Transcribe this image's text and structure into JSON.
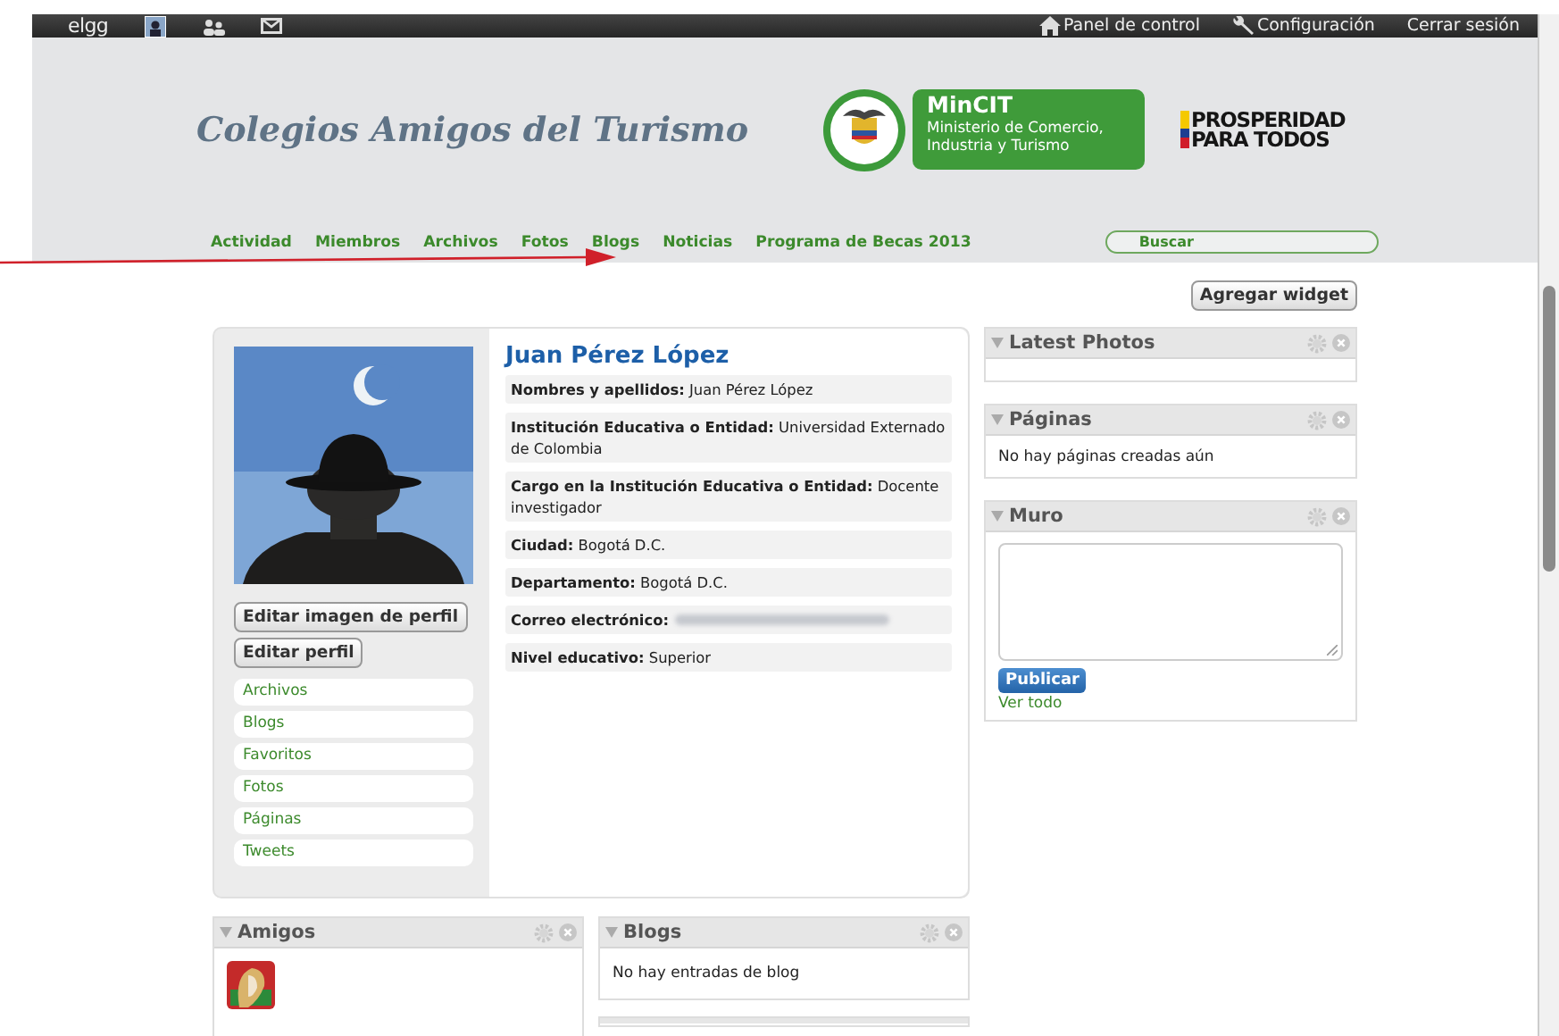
{
  "topbar": {
    "logo": "elgg",
    "icons": [
      {
        "kind": "avatar"
      },
      {
        "kind": "friends"
      },
      {
        "kind": "mail"
      }
    ],
    "links": [
      {
        "kind": "home",
        "label": "Panel de control"
      },
      {
        "kind": "wrench",
        "label": "Configuración"
      },
      {
        "kind": "plain",
        "label": "Cerrar sesión"
      }
    ]
  },
  "header": {
    "title": "Colegios Amigos del Turismo",
    "ministry": {
      "name": "MinCIT",
      "lines": [
        "Ministerio de Comercio,",
        "Industria y Turismo"
      ]
    },
    "slogan": [
      "PROSPERIDAD",
      "PARA TODOS"
    ]
  },
  "nav": {
    "items": [
      "Actividad",
      "Miembros",
      "Archivos",
      "Fotos",
      "Blogs",
      "Noticias",
      "Programa de Becas 2013"
    ],
    "search": {
      "placeholder": "Buscar"
    }
  },
  "add_widget": "Agregar widget",
  "profile": {
    "name": "Juan Pérez López",
    "fields": [
      {
        "kind": "text",
        "text": "**Nombres y apellidos:** Juan Pérez López"
      },
      {
        "kind": "text",
        "text": "**Institución Educativa o Entidad:** Universidad Externado de Colombia"
      },
      {
        "kind": "text",
        "text": "**Cargo en la Institución Educativa o Entidad:** Docente investigador"
      },
      {
        "kind": "text",
        "text": "**Ciudad:** Bogotá D.C."
      },
      {
        "kind": "text",
        "text": "**Departamento:** Bogotá D.C."
      },
      {
        "kind": "redacted",
        "text": "**Correo electrónico:**"
      },
      {
        "kind": "text",
        "text": "**Nivel educativo:** Superior"
      }
    ],
    "buttons": [
      "Editar imagen de perfil",
      "Editar perfil"
    ],
    "menu": [
      "Archivos",
      "Blogs",
      "Favoritos",
      "Fotos",
      "Páginas",
      "Tweets"
    ]
  },
  "right_widgets": [
    {
      "kind": "empty",
      "title": "Latest Photos"
    },
    {
      "kind": "message",
      "title": "Páginas",
      "message": "No hay páginas creadas aún"
    },
    {
      "kind": "wall",
      "title": "Muro",
      "button": "Publicar",
      "link": "Ver todo"
    }
  ],
  "bottom_widgets": [
    {
      "kind": "friends",
      "title": "Amigos"
    },
    {
      "kind": "message",
      "title": "Blogs",
      "message": "No hay entradas de blog"
    }
  ]
}
